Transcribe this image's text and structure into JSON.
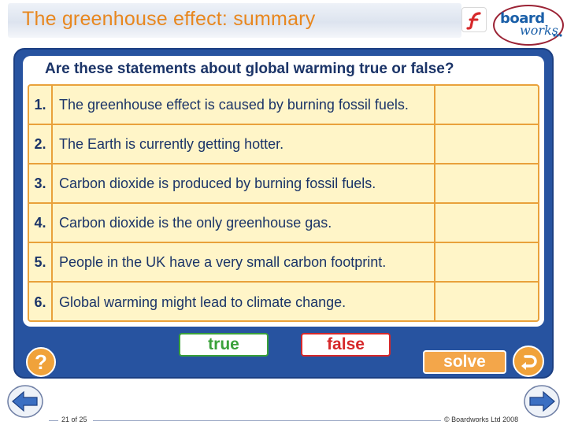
{
  "header": {
    "title": "The greenhouse effect: summary",
    "logo": {
      "top": "board",
      "bottom": "works"
    }
  },
  "activity": {
    "question": "Are these statements about global warming true or false?",
    "statements": [
      {
        "number": "1.",
        "text": "The greenhouse effect is caused by burning fossil fuels."
      },
      {
        "number": "2.",
        "text": "The Earth is currently getting hotter."
      },
      {
        "number": "3.",
        "text": "Carbon dioxide is produced by burning fossil fuels."
      },
      {
        "number": "4.",
        "text": "Carbon dioxide is the only greenhouse gas."
      },
      {
        "number": "5.",
        "text": "People in the UK have a very small carbon footprint."
      },
      {
        "number": "6.",
        "text": "Global warming might lead to climate change."
      }
    ],
    "true_label": "true",
    "false_label": "false",
    "help_label": "?",
    "solve_label": "solve"
  },
  "footer": {
    "page": "21 of 25",
    "copyright": "© Boardworks Ltd 2008"
  },
  "icons": {
    "flash": "flash-player-icon",
    "help": "question-mark-icon",
    "reset": "reset-arrow-icon",
    "prev": "previous-arrow-icon",
    "next": "next-arrow-icon"
  },
  "colors": {
    "title": "#e8871e",
    "panel": "#2753a0",
    "table_fill": "#fff5c8",
    "table_border": "#e9a13b",
    "true": "#3aa13a",
    "false": "#d6282a",
    "solve": "#f3a64a"
  }
}
